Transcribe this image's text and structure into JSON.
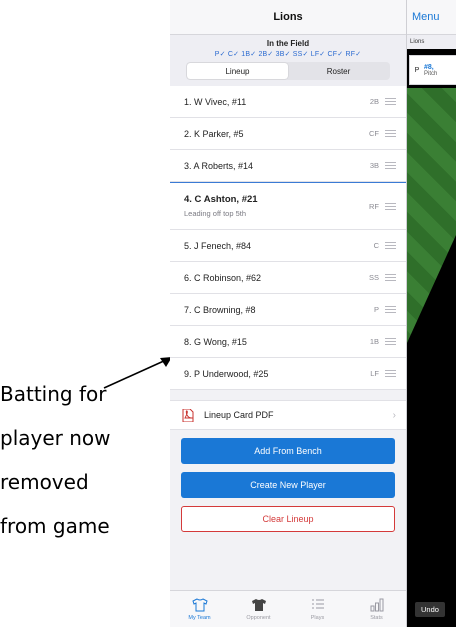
{
  "annotation": {
    "lines": [
      "Batting for",
      "player now",
      "removed",
      "from game"
    ]
  },
  "header": {
    "title": "Lions"
  },
  "field": {
    "title": "In the Field",
    "positions": "P✓  C✓  1B✓  2B✓  3B✓  SS✓  LF✓  CF✓  RF✓"
  },
  "segments": {
    "lineup": "Lineup",
    "roster": "Roster"
  },
  "lineup": [
    {
      "name": "1. W Vivec, #11",
      "pos": "2B"
    },
    {
      "name": "2. K Parker, #5",
      "pos": "CF"
    },
    {
      "name": "3. A Roberts, #14",
      "pos": "3B"
    },
    {
      "name": "4. C Ashton, #21",
      "pos": "RF",
      "sub": "Leading off top 5th"
    },
    {
      "name": "5. J Fenech, #84",
      "pos": "C"
    },
    {
      "name": "6. C Robinson, #62",
      "pos": "SS"
    },
    {
      "name": "7. C Browning, #8",
      "pos": "P"
    },
    {
      "name": "8. G Wong, #15",
      "pos": "1B"
    },
    {
      "name": "9. P Underwood, #25",
      "pos": "LF"
    }
  ],
  "pdf": {
    "label": "Lineup Card PDF"
  },
  "buttons": {
    "add_bench": "Add From Bench",
    "create_player": "Create New Player",
    "clear_lineup": "Clear Lineup"
  },
  "tabs": [
    "My Team",
    "Opponent",
    "Plays",
    "Stats"
  ],
  "right_panel": {
    "menu": "Menu",
    "team": "Lions",
    "card_pos": "P",
    "card_num": "#8,",
    "card_role": "Pitch",
    "undo": "Undo"
  },
  "colors": {
    "accent": "#1a78d6",
    "danger": "#d43a3a",
    "field_green": "#3a7f34"
  }
}
